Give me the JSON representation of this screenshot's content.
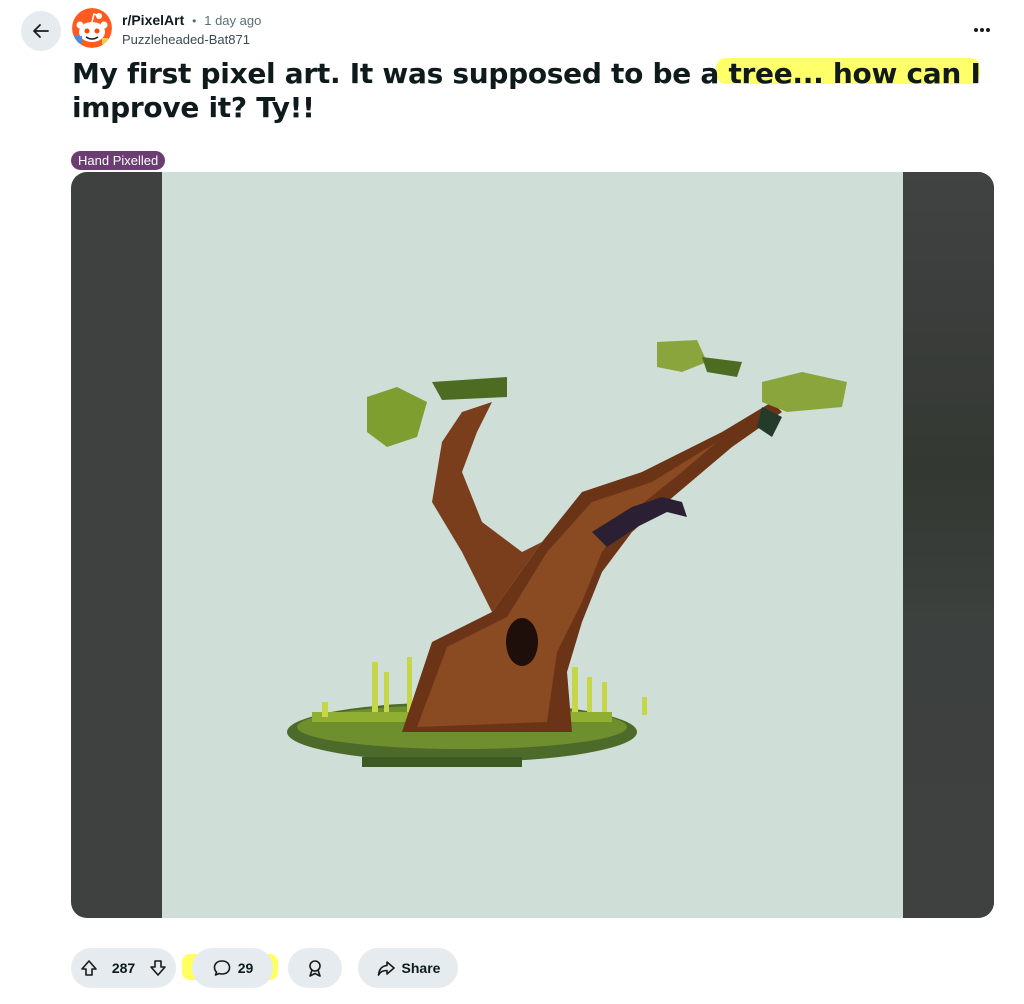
{
  "post": {
    "subreddit": "r/PixelArt",
    "separator": "•",
    "time": "1 day ago",
    "author": "Puzzleheaded-Bat871",
    "title": "My first pixel art. It was supposed to be a tree... how can I improve it? Ty!!",
    "flair": "Hand Pixelled",
    "overflow_label": "..."
  },
  "actions": {
    "upvotes": "287",
    "comments": "29",
    "share_label": "Share"
  },
  "icons": {
    "back": "back-arrow-icon",
    "avatar": "subreddit-avatar-icon",
    "overflow": "more-options-icon",
    "upvote": "upvote-arrow-icon",
    "downvote": "downvote-arrow-icon",
    "comment": "comment-bubble-icon",
    "award": "award-icon",
    "share": "share-arrow-icon"
  },
  "colors": {
    "highlight": "#ffff38",
    "flair_bg": "#6b3d72",
    "pill_bg": "#e5ebee",
    "media_bg": "#cfdfd8",
    "media_letterbox": "#3e4140"
  }
}
